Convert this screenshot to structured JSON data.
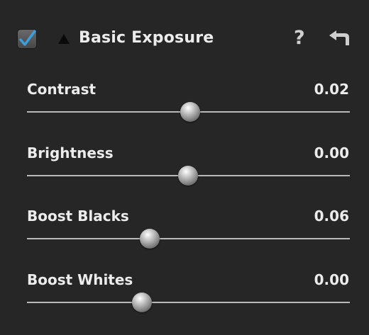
{
  "panel": {
    "title": "Basic Exposure",
    "enabled": true,
    "help_label": "?",
    "icons": {
      "checkbox": "checkmark-icon",
      "collapse": "disclosure-triangle-icon",
      "help": "help-icon",
      "reset": "reset-arrow-icon"
    },
    "accent_color": "#3aa0e0"
  },
  "sliders": [
    {
      "label": "Contrast",
      "value": "0.02",
      "position_fraction": 0.505
    },
    {
      "label": "Brightness",
      "value": "0.00",
      "position_fraction": 0.498
    },
    {
      "label": "Boost Blacks",
      "value": "0.06",
      "position_fraction": 0.38
    },
    {
      "label": "Boost Whites",
      "value": "0.00",
      "position_fraction": 0.357
    }
  ]
}
